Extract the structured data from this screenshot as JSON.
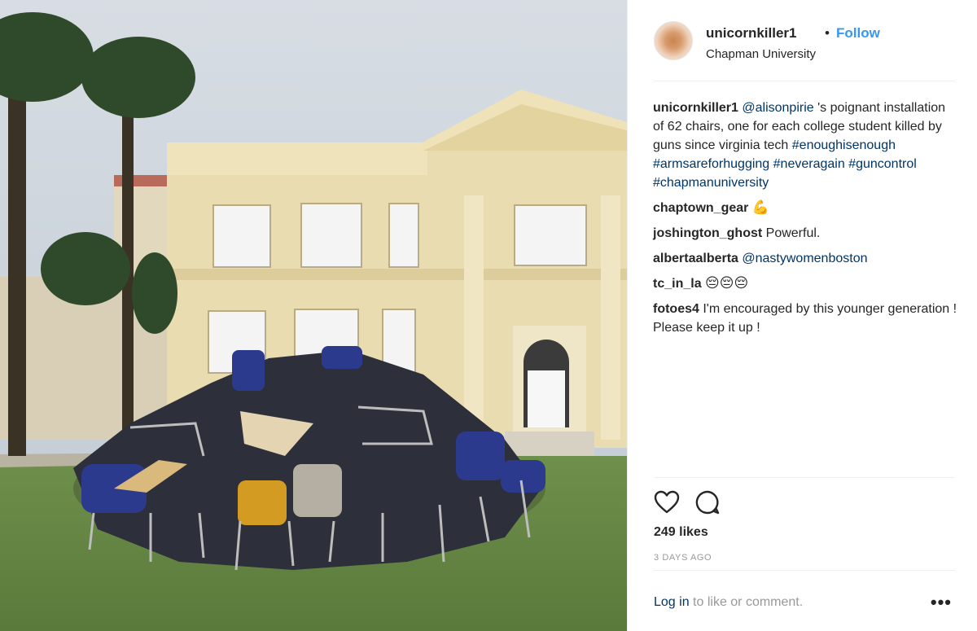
{
  "post": {
    "username": "unicornkiller1",
    "separator": "•",
    "follow_label": "Follow",
    "location": "Chapman University",
    "image_alt": "Installation of stacked chairs on a lawn in front of a building"
  },
  "caption": {
    "user": "unicornkiller1",
    "mention": "@alisonpirie",
    "text": " 's poignant installation of 62 chairs, one for each college student killed by guns since virginia tech ",
    "hashtags": [
      "#enoughisenough",
      "#armsareforhugging",
      "#neveragain",
      "#guncontrol",
      "#chapmanuniversity"
    ]
  },
  "comments": [
    {
      "user": "chaptown_gear",
      "text": "",
      "emoji": "💪"
    },
    {
      "user": "joshington_ghost",
      "text": "Powerful.",
      "emoji": ""
    },
    {
      "user": "albertaalberta",
      "text": "",
      "mention": "@nastywomenboston"
    },
    {
      "user": "tc_in_la",
      "text": "",
      "emoji": "😔😔😔"
    },
    {
      "user": "fotoes4",
      "text": "I'm encouraged by this younger generation !",
      "text2": "Please keep it up !"
    }
  ],
  "actions": {
    "like_icon": "heart-icon",
    "comment_icon": "comment-icon",
    "likes": "249 likes",
    "time": "3 DAYS AGO"
  },
  "footer": {
    "login_label": "Log in",
    "login_suffix": " to like or comment.",
    "more_label": "•••"
  },
  "colors": {
    "link": "#003569",
    "follow": "#3897f0",
    "text": "#262626",
    "muted": "#999999",
    "divider": "#efefef"
  }
}
